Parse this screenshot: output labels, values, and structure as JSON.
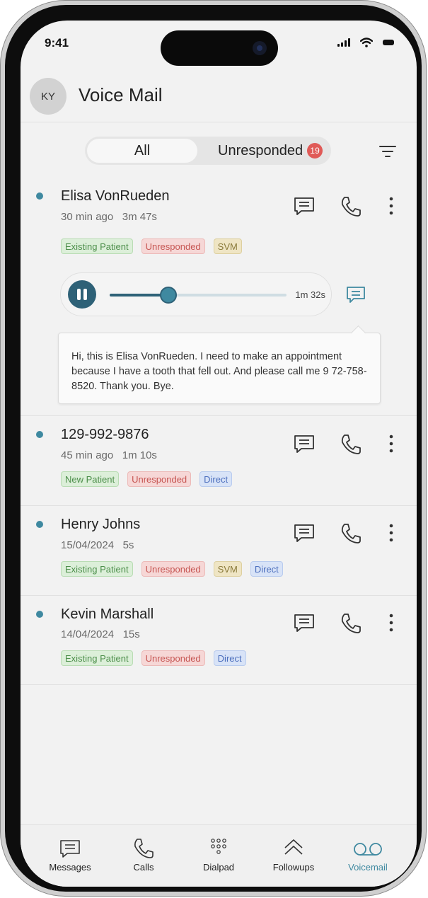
{
  "status_bar": {
    "time": "9:41"
  },
  "header": {
    "avatar_initials": "KY",
    "title": "Voice Mail"
  },
  "filter_tabs": {
    "all": "All",
    "unresponded": "Unresponded",
    "unresponded_count": "19"
  },
  "voicemails": [
    {
      "name": "Elisa VonRueden",
      "time": "30 min ago",
      "duration": "3m 47s",
      "tags": [
        {
          "label": "Existing Patient",
          "color": "green"
        },
        {
          "label": "Unresponded",
          "color": "red"
        },
        {
          "label": "SVM",
          "color": "yellow"
        }
      ]
    },
    {
      "name": "129-992-9876",
      "time": "45 min ago",
      "duration": "1m 10s",
      "tags": [
        {
          "label": "New Patient",
          "color": "green"
        },
        {
          "label": "Unresponded",
          "color": "red"
        },
        {
          "label": "Direct",
          "color": "blue"
        }
      ]
    },
    {
      "name": "Henry Johns",
      "time": "15/04/2024",
      "duration": "5s",
      "tags": [
        {
          "label": "Existing Patient",
          "color": "green"
        },
        {
          "label": "Unresponded",
          "color": "red"
        },
        {
          "label": "SVM",
          "color": "yellow"
        },
        {
          "label": "Direct",
          "color": "blue"
        }
      ]
    },
    {
      "name": "Kevin Marshall",
      "time": "14/04/2024",
      "duration": "15s",
      "tags": [
        {
          "label": "Existing Patient",
          "color": "green"
        },
        {
          "label": "Unresponded",
          "color": "red"
        },
        {
          "label": "Direct",
          "color": "blue"
        }
      ]
    }
  ],
  "player": {
    "remaining": "1m 32s",
    "progress": 0.33
  },
  "transcript": "Hi, this is Elisa VonRueden. I need to make an appointment because I have a tooth that fell out. And please call me 9 72-758-8520. Thank you. Bye.",
  "tab_bar": [
    {
      "label": "Messages",
      "icon": "message-icon",
      "active": false
    },
    {
      "label": "Calls",
      "icon": "phone-icon",
      "active": false
    },
    {
      "label": "Dialpad",
      "icon": "dialpad-icon",
      "active": false
    },
    {
      "label": "Followups",
      "icon": "chevron-up-icon",
      "active": false
    },
    {
      "label": "Voicemail",
      "icon": "voicemail-icon",
      "active": true
    }
  ],
  "colors": {
    "accent": "#3f89a0",
    "accent_dark": "#2e6177",
    "badge": "#e05a57"
  }
}
